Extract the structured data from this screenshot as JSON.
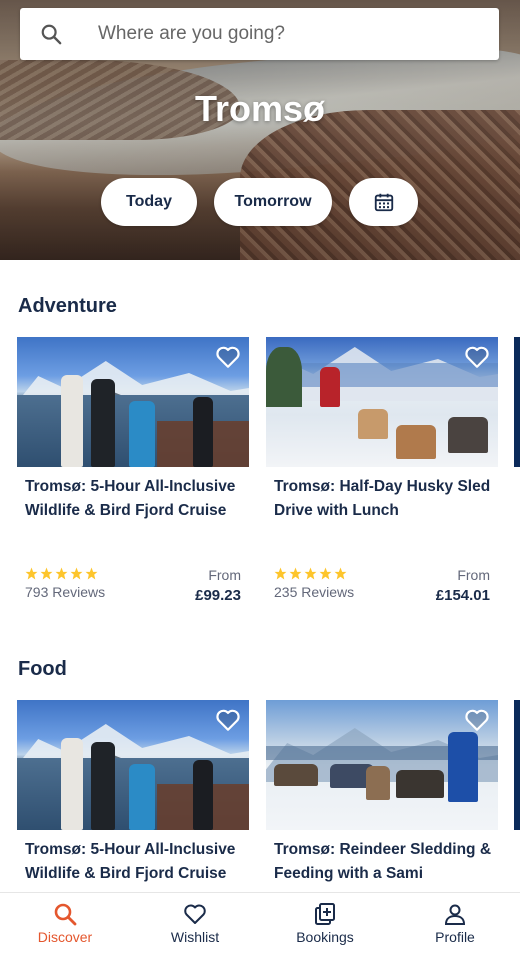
{
  "search": {
    "placeholder": "Where are you going?"
  },
  "hero": {
    "city": "Tromsø"
  },
  "date_buttons": {
    "today": "Today",
    "tomorrow": "Tomorrow"
  },
  "sections": [
    {
      "title": "Adventure",
      "cards": [
        {
          "title": "Tromsø: 5-Hour All-Inclusive Wildlife & Bird Fjord Cruise",
          "rating_stars": 5,
          "reviews": "793 Reviews",
          "from_label": "From",
          "price": "£99.23"
        },
        {
          "title": "Tromsø: Half-Day Husky Sled Drive with Lunch",
          "rating_stars": 5,
          "reviews": "235 Reviews",
          "from_label": "From",
          "price": "£154.01"
        }
      ]
    },
    {
      "title": "Food",
      "cards": [
        {
          "title": "Tromsø: 5-Hour All-Inclusive Wildlife & Bird Fjord Cruise"
        },
        {
          "title": "Tromsø: Reindeer Sledding & Feeding with a Sami"
        }
      ]
    }
  ],
  "nav": [
    {
      "label": "Discover",
      "icon": "search-icon",
      "active": true
    },
    {
      "label": "Wishlist",
      "icon": "heart-icon",
      "active": false
    },
    {
      "label": "Bookings",
      "icon": "bookings-icon",
      "active": false
    },
    {
      "label": "Profile",
      "icon": "profile-icon",
      "active": false
    }
  ],
  "colors": {
    "accent": "#e4572e",
    "text": "#1a2b49",
    "star": "#fdc52c"
  }
}
